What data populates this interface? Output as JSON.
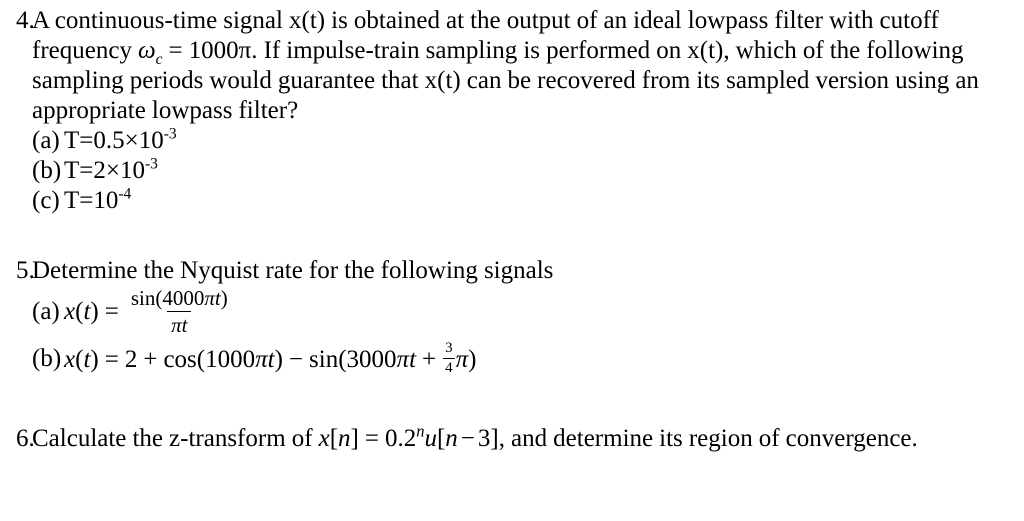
{
  "document": {
    "background_color": "#ffffff",
    "text_color": "#000000"
  },
  "problems": [
    {
      "number": "4.",
      "stem": "A continuous-time signal x(t) is obtained at the output of an ideal lowpass filter with cutoff frequency ωc = 1000π. If impulse-train sampling is performed on x(t), which of the following sampling periods would guarantee that x(t) can be recovered from its sampled version using an appropriate lowpass filter?",
      "stem_parts": {
        "p1": "A continuous-time signal x(t) is obtained at the output of an ideal lowpass filter with cutoff frequency ",
        "omega": "ω",
        "omega_sub": "c",
        "eq": "=",
        "value": "1000π",
        "p2": ". If impulse-train sampling is performed on x(t), which of the following sampling periods would guarantee that x(t) can be recovered from its sampled version using an appropriate lowpass filter?"
      },
      "options": [
        {
          "label": "(a)",
          "text": "T=0.5×10",
          "exponent": "-3",
          "full": "T=0.5×10⁻³"
        },
        {
          "label": "(b)",
          "text": "T=2×10",
          "exponent": "-3",
          "full": "T=2×10⁻³"
        },
        {
          "label": "(c)",
          "text": "T=10",
          "exponent": "-4",
          "full": "T=10⁻⁴"
        }
      ]
    },
    {
      "number": "5.",
      "stem": "Determine the Nyquist rate for the following signals",
      "options": [
        {
          "label": "(a)",
          "full": "x(t) = sin(4000πt) / πt",
          "lhs_var": "x",
          "lhs_open": "(",
          "lhs_arg": "t",
          "lhs_close": ")",
          "equals": "=",
          "numerator_fn": "sin",
          "numerator_open": "(",
          "numerator_coeff": "4000",
          "numerator_pi": "π",
          "numerator_var": "t",
          "numerator_close": ")",
          "denominator_pi": "π",
          "denominator_var": "t"
        },
        {
          "label": "(b)",
          "full": "x(t) = 2 + cos(1000πt) − sin(3000πt + (3/4)π)",
          "lhs_var": "x",
          "lhs_open": "(",
          "lhs_arg": "t",
          "lhs_close": ")",
          "equals": "=",
          "const": "2",
          "plus": "+",
          "cos_fn": "cos",
          "cos_open": "(",
          "cos_coeff": "1000",
          "cos_pi": "π",
          "cos_var": "t",
          "cos_close": ")",
          "minus": "−",
          "sin_fn": "sin",
          "sin_open": "(",
          "sin_coeff": "3000",
          "sin_pi": "π",
          "sin_var": "t",
          "sin_plus": "+",
          "frac_num": "3",
          "frac_den": "4",
          "sin_phase_pi": "π",
          "sin_close": ")"
        }
      ]
    },
    {
      "number": "6.",
      "stem": "Calculate the z-transform of x[n] = 0.2ⁿu[n − 3], and determine its region of convergence.",
      "stem_parts": {
        "p1": "Calculate the z-transform of ",
        "var_x": "x",
        "br_open": "[",
        "var_n": "n",
        "br_close": "]",
        "equals": "=",
        "base": "0.2",
        "exp_n": "n",
        "var_u": "u",
        "u_open": "[",
        "u_var": "n",
        "u_minus": "−",
        "u_shift": "3",
        "u_close": "]",
        "p2": ", and determine its region of",
        "p3": "convergence."
      }
    }
  ]
}
